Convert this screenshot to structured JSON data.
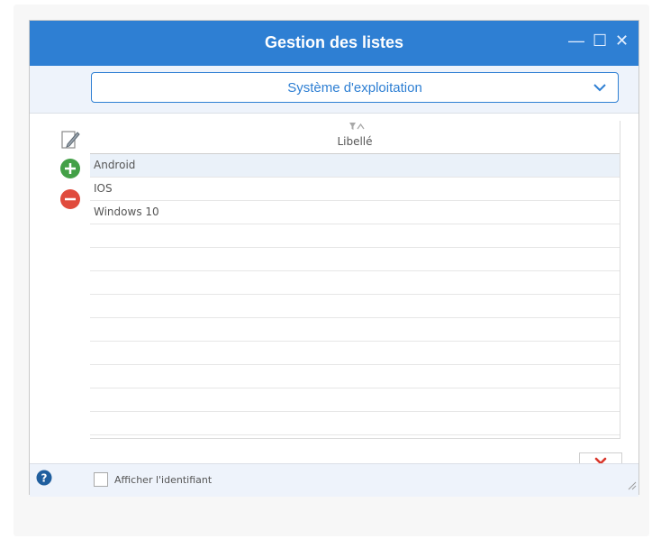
{
  "window": {
    "title": "Gestion des listes",
    "controls": {
      "minimize": "—",
      "maximize": "☐",
      "close": "✕"
    }
  },
  "toolbar": {
    "list_select": {
      "value": "Système d'exploitation",
      "icon": "chevron-down-icon"
    }
  },
  "actions": {
    "edit_icon": "pencil-edit-icon",
    "add_icon": "plus-circle-icon",
    "remove_icon": "minus-circle-icon"
  },
  "grid": {
    "column": {
      "label": "Libellé",
      "sort_icon": "filter-sort-icon"
    },
    "rows": [
      "Android",
      "IOS",
      "Windows 10",
      "",
      "",
      "",
      "",
      "",
      "",
      "",
      "",
      ""
    ],
    "selected_row": 0
  },
  "footer": {
    "help_icon": "question-icon",
    "checkbox_label": "Afficher l'identifiant",
    "checkbox_checked": false,
    "close_icon": "red-x-icon"
  },
  "colors": {
    "accent": "#2e7fd3",
    "add": "#43a047",
    "remove": "#e04b3d",
    "close": "#d9362b"
  }
}
